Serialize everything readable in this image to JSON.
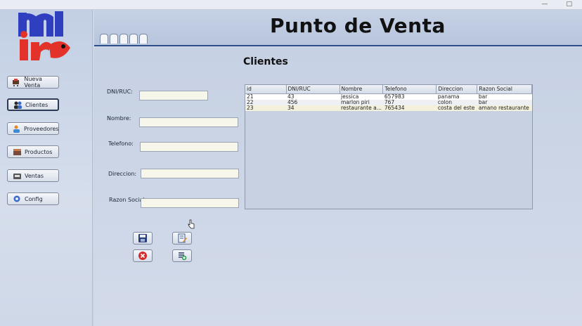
{
  "window": {
    "minimize_glyph": "—",
    "maximize_glyph": "□"
  },
  "header": {
    "title": "Punto de Venta"
  },
  "sidebar": {
    "items": [
      {
        "label": "Nueva Venta",
        "icon": "cart-icon"
      },
      {
        "label": "Clientes",
        "icon": "users-icon",
        "active": true
      },
      {
        "label": "Proveedores",
        "icon": "supplier-icon"
      },
      {
        "label": "Productos",
        "icon": "box-icon"
      },
      {
        "label": "Ventas",
        "icon": "sales-icon"
      },
      {
        "label": "Config",
        "icon": "gear-icon"
      }
    ]
  },
  "form": {
    "section_title": "Clientes",
    "fields": [
      {
        "label": "DNI/RUC:",
        "value": ""
      },
      {
        "label": "Nombre:",
        "value": ""
      },
      {
        "label": "Telefono:",
        "value": ""
      },
      {
        "label": "Direccion:",
        "value": ""
      },
      {
        "label": "Razon Social:",
        "value": ""
      }
    ]
  },
  "table": {
    "columns": [
      "id",
      "DNI/RUC",
      "Nombre",
      "Telefono",
      "Direccion",
      "Razon Social"
    ],
    "rows": [
      [
        "21",
        "43",
        "jessica",
        "657983",
        "panama",
        "bar"
      ],
      [
        "22",
        "456",
        "marlon piri",
        "767",
        "colon",
        "bar"
      ],
      [
        "23",
        "34",
        "restaurante a...",
        "765434",
        "costa del este",
        "amano restaurante"
      ]
    ]
  },
  "actions": [
    {
      "name": "save-button",
      "icon": "floppy-icon"
    },
    {
      "name": "edit-button",
      "icon": "edit-icon"
    },
    {
      "name": "delete-button",
      "icon": "delete-icon"
    },
    {
      "name": "new-button",
      "icon": "new-record-icon"
    }
  ],
  "colors": {
    "accent": "#2c4e8c",
    "logo_blue": "#2f3fbf",
    "logo_red": "#e2322a",
    "delete_red": "#d42a2a"
  }
}
